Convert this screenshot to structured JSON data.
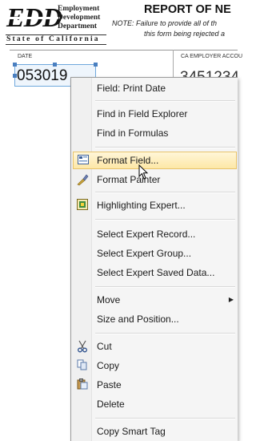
{
  "header": {
    "logo_text": "EDD",
    "dept_lines": [
      "Employment",
      "Development",
      "Department"
    ],
    "state_text": "State of California",
    "report_title": "REPORT OF NE",
    "note_line1": "NOTE: Failure to provide all of th",
    "note_line2": "this form being rejected a"
  },
  "fields": {
    "date_label": "DATE",
    "date_value": "053019",
    "employer_label": "CA EMPLOYER ACCOU",
    "employer_value": "3451234"
  },
  "context_menu": {
    "items": [
      {
        "label": "Field: Print Date",
        "icon": ""
      },
      {
        "label": "Find in Field Explorer",
        "icon": ""
      },
      {
        "label": "Find in Formulas",
        "icon": ""
      },
      {
        "label": "Format Field...",
        "icon": "format-field-icon",
        "highlighted": true
      },
      {
        "label": "Format Painter",
        "icon": "format-painter-icon"
      },
      {
        "label": "Highlighting Expert...",
        "icon": "highlighting-expert-icon"
      },
      {
        "label": "Select Expert Record...",
        "icon": ""
      },
      {
        "label": "Select Expert Group...",
        "icon": ""
      },
      {
        "label": "Select Expert Saved Data...",
        "icon": ""
      },
      {
        "label": "Move",
        "icon": "",
        "submenu": true
      },
      {
        "label": "Size and Position...",
        "icon": ""
      },
      {
        "label": "Cut",
        "icon": "cut-icon"
      },
      {
        "label": "Copy",
        "icon": "copy-icon"
      },
      {
        "label": "Paste",
        "icon": "paste-icon"
      },
      {
        "label": "Delete",
        "icon": ""
      },
      {
        "label": "Copy Smart Tag",
        "icon": ""
      }
    ]
  },
  "colors": {
    "menu_highlight": "#fde7a6",
    "selection_border": "#4a7fc0"
  }
}
